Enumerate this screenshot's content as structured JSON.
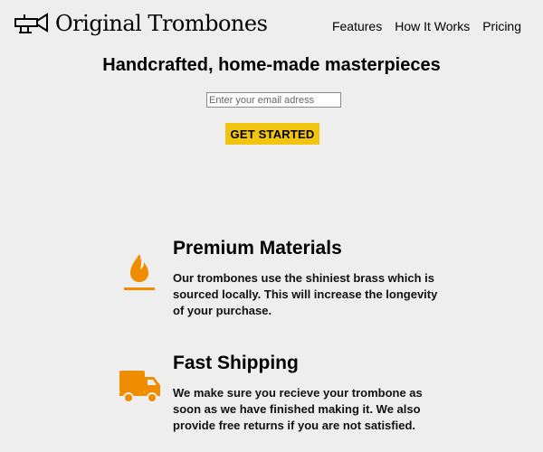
{
  "brand": {
    "name": "Original Trombones",
    "logo_icon": "trombone-icon"
  },
  "nav": {
    "items": [
      "Features",
      "How It Works",
      "Pricing"
    ]
  },
  "hero": {
    "title": "Handcrafted, home-made masterpieces",
    "email_placeholder": "Enter your email adress",
    "cta_label": "GET STARTED",
    "cta_color": "#f1c40f"
  },
  "features": [
    {
      "icon": "fire-icon",
      "title": "Premium Materials",
      "description": "Our trombones use the shiniest brass which is sourced locally. This will increase the longevity of your purchase."
    },
    {
      "icon": "truck-icon",
      "title": "Fast Shipping",
      "description": "We make sure you recieve your trombone as soon as we have finished making it. We also provide free returns if you are not satisfied."
    }
  ],
  "colors": {
    "background": "#eeeeee",
    "accent": "#f08c00"
  }
}
